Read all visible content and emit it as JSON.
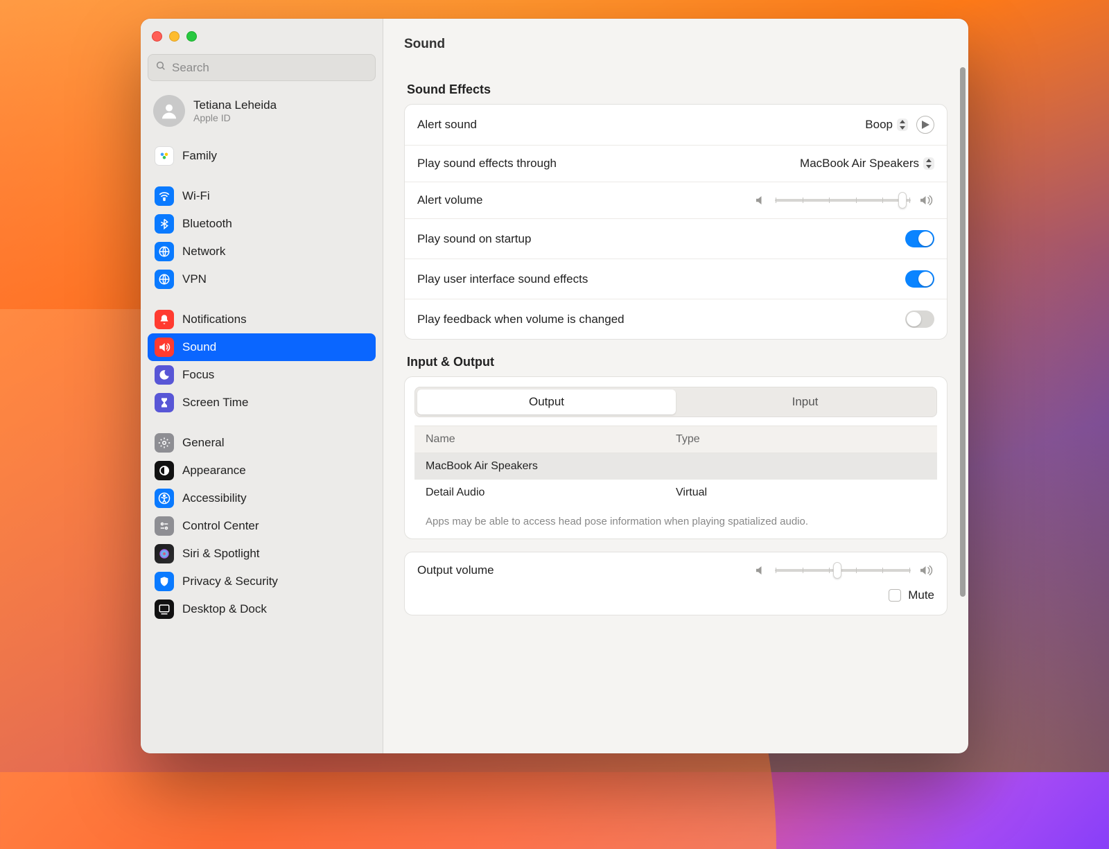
{
  "window": {
    "title": "Sound"
  },
  "search": {
    "placeholder": "Search"
  },
  "account": {
    "name": "Tetiana Leheida",
    "sub": "Apple ID"
  },
  "sidebar": {
    "groups": [
      [
        {
          "label": "Family",
          "color": "#ffffff",
          "border": true
        }
      ],
      [
        {
          "label": "Wi-Fi",
          "color": "#0a7aff"
        },
        {
          "label": "Bluetooth",
          "color": "#0a7aff"
        },
        {
          "label": "Network",
          "color": "#0a7aff"
        },
        {
          "label": "VPN",
          "color": "#0a7aff"
        }
      ],
      [
        {
          "label": "Notifications",
          "color": "#ff3b30"
        },
        {
          "label": "Sound",
          "color": "#ff3b30",
          "active": true
        },
        {
          "label": "Focus",
          "color": "#5856d6"
        },
        {
          "label": "Screen Time",
          "color": "#5856d6"
        }
      ],
      [
        {
          "label": "General",
          "color": "#8e8e93"
        },
        {
          "label": "Appearance",
          "color": "#111111"
        },
        {
          "label": "Accessibility",
          "color": "#0a7aff"
        },
        {
          "label": "Control Center",
          "color": "#8e8e93"
        },
        {
          "label": "Siri & Spotlight",
          "color": "gradient"
        },
        {
          "label": "Privacy & Security",
          "color": "#0a7aff"
        },
        {
          "label": "Desktop & Dock",
          "color": "#111111"
        }
      ]
    ]
  },
  "sections": {
    "effects_title": "Sound Effects",
    "io_title": "Input & Output"
  },
  "effects": {
    "alert_sound_label": "Alert sound",
    "alert_sound_value": "Boop",
    "play_through_label": "Play sound effects through",
    "play_through_value": "MacBook Air Speakers",
    "alert_volume_label": "Alert volume",
    "alert_volume_percent": 94,
    "startup_label": "Play sound on startup",
    "startup_on": true,
    "ui_sounds_label": "Play user interface sound effects",
    "ui_sounds_on": true,
    "feedback_label": "Play feedback when volume is changed",
    "feedback_on": false
  },
  "io": {
    "tabs": {
      "output": "Output",
      "input": "Input",
      "active": "output"
    },
    "columns": {
      "name": "Name",
      "type": "Type"
    },
    "devices": [
      {
        "name": "MacBook Air Speakers",
        "type": "",
        "selected": true
      },
      {
        "name": "Detail Audio",
        "type": "Virtual",
        "selected": false
      }
    ],
    "footnote": "Apps may be able to access head pose information when playing spatialized audio."
  },
  "output_volume": {
    "label": "Output volume",
    "percent": 46,
    "mute_label": "Mute",
    "mute_checked": false
  }
}
